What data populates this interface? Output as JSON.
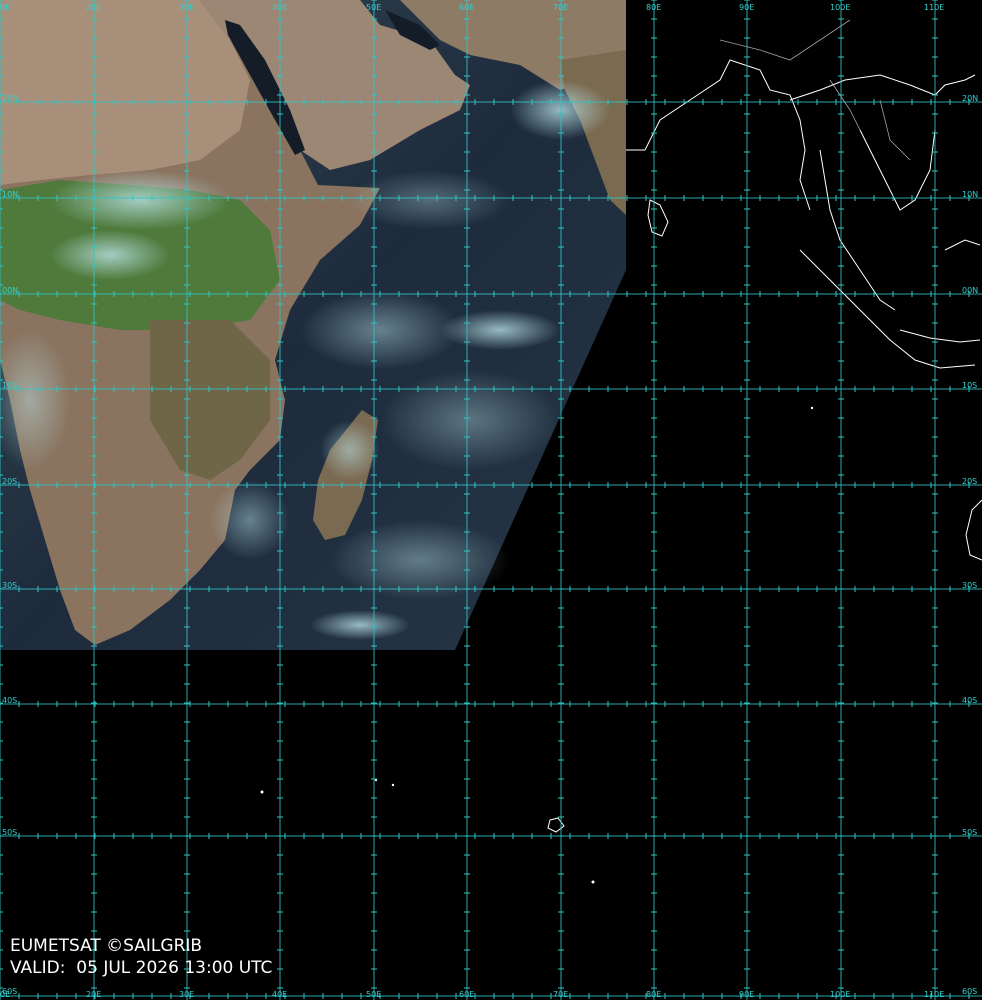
{
  "credit": "EUMETSAT ©SAILGRIB",
  "valid_label": "VALID:",
  "valid_time": "05 JUL 2026 13:00 UTC",
  "lon_labels_top": [
    "0E",
    "20E",
    "30E",
    "40E",
    "50E",
    "60E",
    "70E",
    "80E",
    "90E",
    "100E",
    "110E"
  ],
  "lon_labels_bottom": [
    "0E",
    "20E",
    "30E",
    "40E",
    "50E",
    "60E",
    "70E",
    "80E",
    "90E",
    "100E",
    "110E"
  ],
  "lat_labels_left": [
    "20N",
    "10N",
    "00N",
    "10S",
    "20S",
    "30S",
    "40S",
    "50S",
    "60S"
  ],
  "lat_labels_right": [
    "20N",
    "10N",
    "00N",
    "10S",
    "20S",
    "30S",
    "40S",
    "50S",
    "60S"
  ],
  "colors": {
    "background": "#000000",
    "grid": "#2fc6c6",
    "label": "#33d0d0",
    "coast": "#ffffff",
    "desert": "#9a8370",
    "vegetation": "#4f7a3c",
    "savanna": "#7a6a4a",
    "ocean": "#1c2b3e",
    "cloud": "#6fe3e8"
  }
}
